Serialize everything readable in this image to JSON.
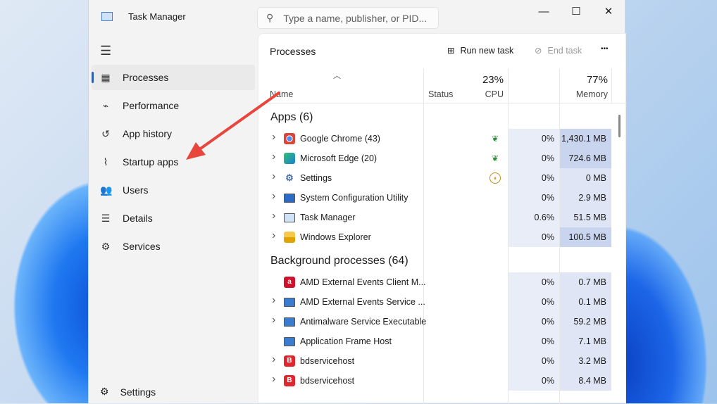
{
  "window": {
    "title": "Task Manager",
    "search_placeholder": "Type a name, publisher, or PID...",
    "minimize": "—",
    "maximize": "☐",
    "close": "✕"
  },
  "sidebar": {
    "items": [
      {
        "label": "Processes",
        "icon": "processes-icon",
        "glyph": "▦"
      },
      {
        "label": "Performance",
        "icon": "performance-icon",
        "glyph": "⌁"
      },
      {
        "label": "App history",
        "icon": "history-icon",
        "glyph": "↺"
      },
      {
        "label": "Startup apps",
        "icon": "startup-icon",
        "glyph": "⌇"
      },
      {
        "label": "Users",
        "icon": "users-icon",
        "glyph": "👥"
      },
      {
        "label": "Details",
        "icon": "details-icon",
        "glyph": "☰"
      },
      {
        "label": "Services",
        "icon": "services-icon",
        "glyph": "⚙"
      }
    ],
    "settings": "Settings"
  },
  "toolbar": {
    "title": "Processes",
    "run_new_task": "Run new task",
    "end_task": "End task",
    "more": "•••"
  },
  "columns": {
    "name": "Name",
    "status": "Status",
    "cpu_pct": "23%",
    "cpu": "CPU",
    "mem_pct": "77%",
    "mem": "Memory"
  },
  "groups": [
    {
      "label": "Apps (6)",
      "rows": [
        {
          "name": "Google Chrome (43)",
          "icon": "chrome",
          "expand": true,
          "status": "eco",
          "cpu": "0%",
          "mem": "1,430.1 MB",
          "hi": true
        },
        {
          "name": "Microsoft Edge (20)",
          "icon": "edge",
          "expand": true,
          "status": "eco",
          "cpu": "0%",
          "mem": "724.6 MB",
          "hi": true
        },
        {
          "name": "Settings",
          "icon": "settings",
          "expand": true,
          "status": "paused",
          "cpu": "0%",
          "mem": "0 MB",
          "hi": false
        },
        {
          "name": "System Configuration Utility",
          "icon": "sysconfig",
          "expand": true,
          "status": "",
          "cpu": "0%",
          "mem": "2.9 MB",
          "hi": false
        },
        {
          "name": "Task Manager",
          "icon": "taskmgr",
          "expand": true,
          "status": "",
          "cpu": "0.6%",
          "mem": "51.5 MB",
          "hi": false
        },
        {
          "name": "Windows Explorer",
          "icon": "explorer",
          "expand": true,
          "status": "",
          "cpu": "0%",
          "mem": "100.5 MB",
          "hi": true
        }
      ]
    },
    {
      "label": "Background processes (64)",
      "rows": [
        {
          "name": "AMD External Events Client M...",
          "icon": "amd",
          "expand": false,
          "status": "",
          "cpu": "0%",
          "mem": "0.7 MB",
          "hi": false
        },
        {
          "name": "AMD External Events Service ...",
          "icon": "service",
          "expand": true,
          "status": "",
          "cpu": "0%",
          "mem": "0.1 MB",
          "hi": false
        },
        {
          "name": "Antimalware Service Executable",
          "icon": "service",
          "expand": true,
          "status": "",
          "cpu": "0%",
          "mem": "59.2 MB",
          "hi": false
        },
        {
          "name": "Application Frame Host",
          "icon": "service",
          "expand": false,
          "status": "",
          "cpu": "0%",
          "mem": "7.1 MB",
          "hi": false
        },
        {
          "name": "bdservicehost",
          "icon": "bitdefender",
          "expand": true,
          "status": "",
          "cpu": "0%",
          "mem": "3.2 MB",
          "hi": false
        },
        {
          "name": "bdservicehost",
          "icon": "bitdefender",
          "expand": true,
          "status": "",
          "cpu": "0%",
          "mem": "8.4 MB",
          "hi": false
        }
      ]
    }
  ],
  "colors": {
    "accent": "#2a5fb0",
    "arrow": "#e8453c"
  }
}
